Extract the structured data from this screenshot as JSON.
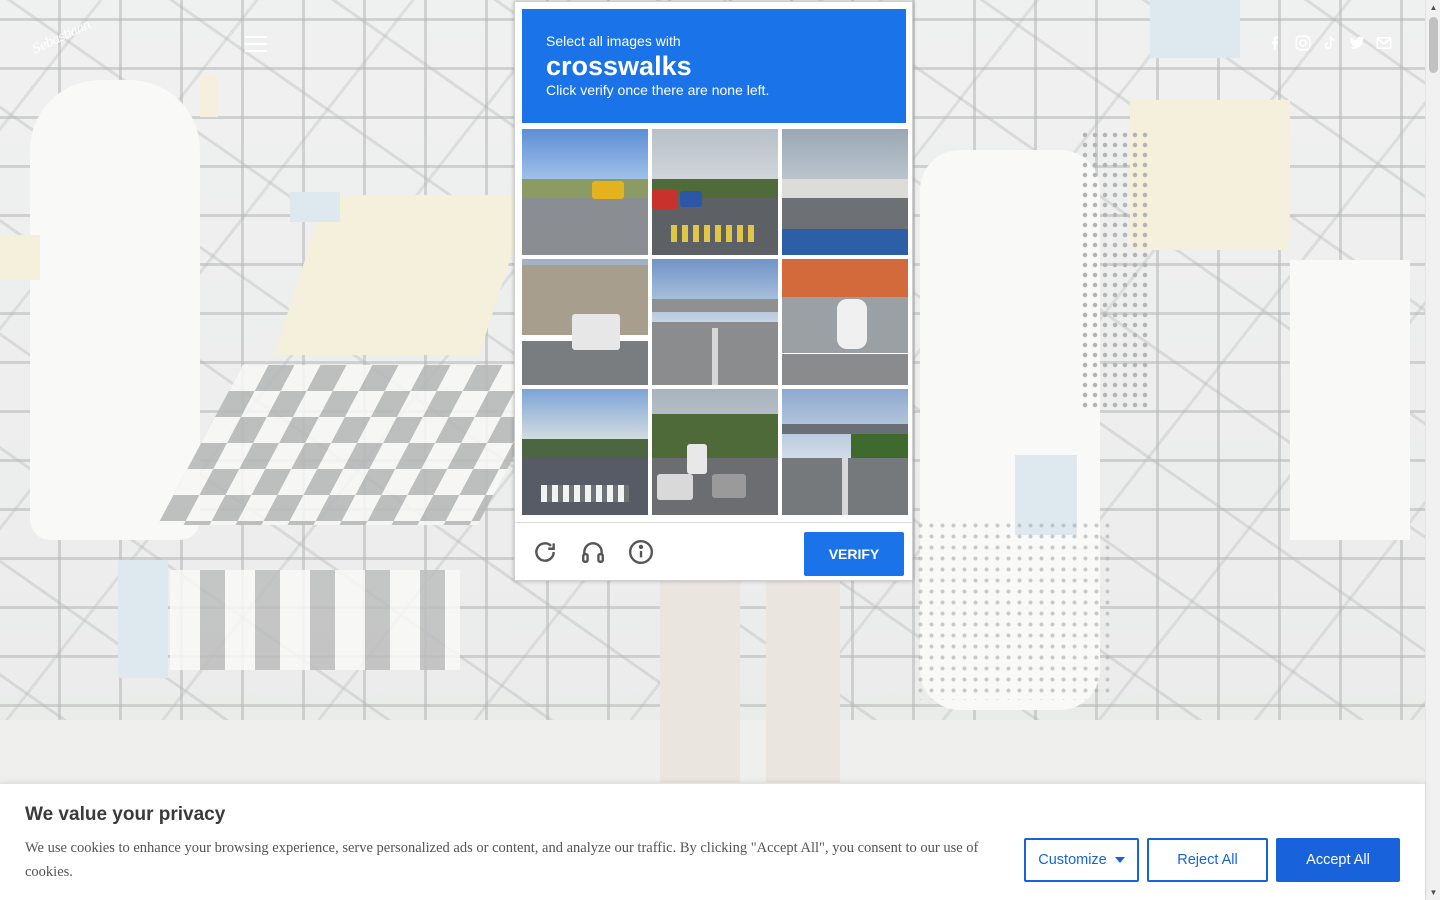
{
  "site": {
    "logo_text": "Sebastiaan",
    "social_icons": [
      "facebook-icon",
      "instagram-icon",
      "tiktok-icon",
      "twitter-icon",
      "email-icon"
    ]
  },
  "captcha": {
    "instruction": "Select all images with",
    "target": "crosswalks",
    "subtext": "Click verify once there are none left.",
    "verify_label": "VERIFY",
    "tools": [
      "reload-icon",
      "audio-icon",
      "info-icon"
    ],
    "accent_color": "#1a73e8",
    "tiles": [
      {
        "name": "tile-school-bus-intersection"
      },
      {
        "name": "tile-parking-lot-crosswalk"
      },
      {
        "name": "tile-gas-station-road"
      },
      {
        "name": "tile-bus-buildings"
      },
      {
        "name": "tile-highway-overpass"
      },
      {
        "name": "tile-parked-scooter"
      },
      {
        "name": "tile-sunny-crosswalk"
      },
      {
        "name": "tile-traffic-trees"
      },
      {
        "name": "tile-bridge-road"
      }
    ]
  },
  "cookie_banner": {
    "title": "We value your privacy",
    "text": "We use cookies to enhance your browsing experience, serve personalized ads or content, and analyze our traffic. By clicking \"Accept All\", you consent to our use of cookies.",
    "customize_label": "Customize",
    "reject_label": "Reject All",
    "accept_label": "Accept All",
    "brand_color": "#1863dc"
  }
}
